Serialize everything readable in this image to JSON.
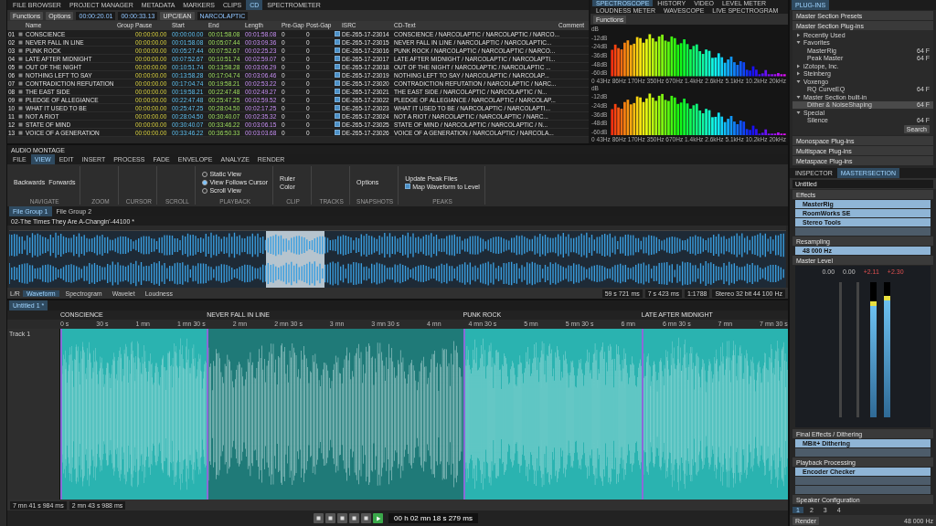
{
  "cd_panel": {
    "tabs": [
      {
        "label": "FILE BROWSER",
        "selected": false
      },
      {
        "label": "PROJECT MANAGER",
        "selected": false
      },
      {
        "label": "METADATA",
        "selected": false
      },
      {
        "label": "MARKERS",
        "selected": false
      },
      {
        "label": "CLIPS",
        "selected": false
      },
      {
        "label": "CD",
        "selected": true
      },
      {
        "label": "SPECTROMETER",
        "selected": false
      }
    ],
    "toolbar": {
      "buttons": [
        "Functions",
        "Options"
      ],
      "time_a": "00:00:20.01",
      "time_b": "00:00:33.13",
      "code_label": "UPC/EAN",
      "album": "NARCOLAPTIC"
    },
    "columns": [
      "Name",
      "Group",
      "Pause",
      "Start",
      "End",
      "Length",
      "Pre-Gap",
      "Post-Gap",
      "ISRC",
      "CD-Text",
      "Comment"
    ],
    "rows": [
      {
        "num": "01",
        "name": "CONSCIENCE",
        "pause": "00:00:00.00",
        "start": "00:00:00.00",
        "end": "00:01:58.08",
        "length": "00:01:58.08",
        "pre": "0",
        "post": "0",
        "checked": true,
        "isrc": "DE-265-17-23014",
        "cdtext": "CONSCIENCE / NARCOLAPTIC / NARCOLAPTIC / NARCO..."
      },
      {
        "num": "02",
        "name": "NEVER FALL IN LINE",
        "pause": "00:00:00.00",
        "start": "00:01:58.08",
        "end": "00:05:07.44",
        "length": "00:03:09.36",
        "pre": "0",
        "post": "0",
        "checked": true,
        "isrc": "DE-265-17-23015",
        "cdtext": "NEVER FALL IN LINE / NARCOLAPTIC / NARCOLAPTIC..."
      },
      {
        "num": "03",
        "name": "PUNK ROCK",
        "pause": "00:00:00.00",
        "start": "00:05:27.44",
        "end": "00:07:52.67",
        "length": "00:02:25.23",
        "pre": "0",
        "post": "0",
        "checked": true,
        "isrc": "DE-265-17-23016",
        "cdtext": "PUNK ROCK / NARCOLAPTIC / NARCOLAPTIC / NARCO..."
      },
      {
        "num": "04",
        "name": "LATE AFTER MIDNIGHT",
        "pause": "00:00:00.00",
        "start": "00:07:52.67",
        "end": "00:10:51.74",
        "length": "00:02:59.07",
        "pre": "0",
        "post": "0",
        "checked": true,
        "isrc": "DE-265-17-23017",
        "cdtext": "LATE AFTER MIDNIGHT / NARCOLAPTIC / NARCOLAPTI..."
      },
      {
        "num": "05",
        "name": "OUT OF THE NIGHT",
        "pause": "00:00:00.00",
        "start": "00:10:51.74",
        "end": "00:13:58.28",
        "length": "00:03:06.29",
        "pre": "0",
        "post": "0",
        "checked": true,
        "isrc": "DE-265-17-23018",
        "cdtext": "OUT OF THE NIGHT / NARCOLAPTIC / NARCOLAPTIC ..."
      },
      {
        "num": "06",
        "name": "NOTHING LEFT TO SAY",
        "pause": "00:00:00.00",
        "start": "00:13:58.28",
        "end": "00:17:04.74",
        "length": "00:03:06.46",
        "pre": "0",
        "post": "0",
        "checked": true,
        "isrc": "DE-265-17-23019",
        "cdtext": "NOTHING LEFT TO SAY / NARCOLAPTIC / NARCOLAP..."
      },
      {
        "num": "07",
        "name": "CONTRADICTION REFUTATION",
        "pause": "00:00:00.00",
        "start": "00:17:04.74",
        "end": "00:19:58.21",
        "length": "00:02:53.22",
        "pre": "0",
        "post": "0",
        "checked": true,
        "isrc": "DE-265-17-23020",
        "cdtext": "CONTRADICTION REFUTATION / NARCOLAPTIC / NARC..."
      },
      {
        "num": "08",
        "name": "THE EAST SIDE",
        "pause": "00:00:00.00",
        "start": "00:19:58.21",
        "end": "00:22:47.48",
        "length": "00:02:49.27",
        "pre": "0",
        "post": "0",
        "checked": true,
        "isrc": "DE-265-17-23021",
        "cdtext": "THE EAST SIDE / NARCOLAPTIC / NARCOLAPTIC / N..."
      },
      {
        "num": "09",
        "name": "PLEDGE OF ALLEGIANCE",
        "pause": "00:00:00.00",
        "start": "00:22:47.48",
        "end": "00:25:47.25",
        "length": "00:02:59.52",
        "pre": "0",
        "post": "0",
        "checked": true,
        "isrc": "DE-265-17-23022",
        "cdtext": "PLEDGE OF ALLEGIANCE / NARCOLAPTIC / NARCOLAP..."
      },
      {
        "num": "10",
        "name": "WHAT IT USED TO BE",
        "pause": "00:00:00.00",
        "start": "00:25:47.25",
        "end": "00:28:04.50",
        "length": "00:02:17.25",
        "pre": "0",
        "post": "0",
        "checked": true,
        "isrc": "DE-265-17-23023",
        "cdtext": "WHAT IT USED TO BE / NARCOLAPTIC / NARCOLAPTI..."
      },
      {
        "num": "11",
        "name": "NOT A RIOT",
        "pause": "00:00:00.00",
        "start": "00:28:04.50",
        "end": "00:30:40.07",
        "length": "00:02:35.32",
        "pre": "0",
        "post": "0",
        "checked": true,
        "isrc": "DE-265-17-23024",
        "cdtext": "NOT A RIOT / NARCOLAPTIC / NARCOLAPTIC / NARC..."
      },
      {
        "num": "12",
        "name": "STATE OF MIND",
        "pause": "00:00:00.00",
        "start": "00:30:40.07",
        "end": "00:33:46.22",
        "length": "00:03:06.15",
        "pre": "0",
        "post": "0",
        "checked": true,
        "isrc": "DE-265-17-23025",
        "cdtext": "STATE OF MIND / NARCOLAPTIC / NARCOLAPTIC / N..."
      },
      {
        "num": "13",
        "name": "VOICE OF A GENERATION",
        "pause": "00:00:00.00",
        "start": "00:33:46.22",
        "end": "00:36:50.33",
        "length": "00:03:03.68",
        "pre": "0",
        "post": "0",
        "checked": true,
        "isrc": "DE-265-17-23026",
        "cdtext": "VOICE OF A GENERATION / NARCOLAPTIC / NARCOLA..."
      }
    ]
  },
  "spectrum_panel": {
    "tabs": [
      {
        "label": "SPECTROSCOPE",
        "selected": true
      },
      {
        "label": "HISTORY",
        "selected": false
      },
      {
        "label": "VIDEO",
        "selected": false
      },
      {
        "label": "LEVEL METER",
        "selected": false
      },
      {
        "label": "LOUDNESS METER",
        "selected": false
      },
      {
        "label": "WAVESCOPE",
        "selected": false
      },
      {
        "label": "LIVE SPECTROGRAM",
        "selected": false
      }
    ],
    "functions": "Functions",
    "charts": [
      {
        "unit": "dB",
        "y_labels": [
          "-12dB",
          "-24dB",
          "-36dB",
          "-48dB",
          "-60dB"
        ],
        "x_labels": [
          "0",
          "43Hz",
          "86Hz",
          "170Hz",
          "350Hz",
          "670Hz",
          "1.4kHz",
          "2.6kHz",
          "5.1kHz",
          "10.2kHz",
          "20kHz"
        ]
      },
      {
        "unit": "dB",
        "y_labels": [
          "-12dB",
          "-24dB",
          "-36dB",
          "-48dB",
          "-60dB"
        ],
        "x_labels": [
          "0",
          "43Hz",
          "86Hz",
          "170Hz",
          "350Hz",
          "670Hz",
          "1.4kHz",
          "2.6kHz",
          "5.1kHz",
          "10.2kHz",
          "20kHz"
        ]
      }
    ]
  },
  "montage": {
    "title": "AUDIO MONTAGE",
    "ribbon_tabs": [
      {
        "label": "FILE",
        "selected": false
      },
      {
        "label": "VIEW",
        "selected": true
      },
      {
        "label": "EDIT",
        "selected": false
      },
      {
        "label": "INSERT",
        "selected": false
      },
      {
        "label": "PROCESS",
        "selected": false
      },
      {
        "label": "FADE",
        "selected": false
      },
      {
        "label": "ENVELOPE",
        "selected": false
      },
      {
        "label": "ANALYZE",
        "selected": false
      },
      {
        "label": "RENDER",
        "selected": false
      }
    ],
    "groups": [
      "NAVIGATE",
      "ZOOM",
      "CURSOR",
      "SCROLL",
      "PLAYBACK",
      "CLIP",
      "TRACKS",
      "SNAPSHOTS",
      "PEAKS"
    ],
    "nav": [
      "Backwards",
      "Forwards"
    ],
    "playback": [
      {
        "label": "Static View",
        "selected": false
      },
      {
        "label": "View Follows Cursor",
        "selected": true
      },
      {
        "label": "Scroll View",
        "selected": false
      }
    ],
    "clip": [
      "Ruler",
      "Color"
    ],
    "snapshots": "Options",
    "peaks_button": "Update Peak Files",
    "map_waveform": {
      "label": "Map Waveform to Level",
      "checked": true
    },
    "file_tabs": [
      {
        "label": "File Group 1",
        "selected": true
      },
      {
        "label": "File Group 2",
        "selected": false
      }
    ],
    "wave_title": "02-The Times They Are A-Changin'-44100 *",
    "view_label": "L/R",
    "view_tabs": [
      {
        "label": "Waveform",
        "selected": true
      },
      {
        "label": "Spectrogram",
        "selected": false
      },
      {
        "label": "Wavelet",
        "selected": false
      },
      {
        "label": "Loudness",
        "selected": false
      }
    ],
    "status": [
      "59 s 721 ms",
      "7 s 423 ms",
      "1:1788",
      "Stereo 32 bit 44 100 Hz"
    ],
    "montage_tab": "Untitled 1 *",
    "ruler": [
      "0 s",
      "30 s",
      "1 mn",
      "1 mn 30 s",
      "2 mn",
      "2 mn 30 s",
      "3 mn",
      "3 mn 30 s",
      "4 mn",
      "4 mn 30 s",
      "5 mn",
      "5 mn 30 s",
      "6 mn",
      "6 mn 30 s",
      "7 mn",
      "7 mn 30 s"
    ],
    "track": {
      "name": "Track 1"
    },
    "clips": [
      {
        "marker": "CONSCIENCE",
        "selected": false
      },
      {
        "marker": "NEVER FALL IN LINE",
        "selected": true
      },
      {
        "marker": "PUNK ROCK",
        "selected": false
      },
      {
        "marker": "LATE AFTER MIDNIGHT",
        "selected": false
      }
    ],
    "bottom_status": [
      "7 mn 41 s 984 ms",
      "2 mn 43 s 988 ms"
    ]
  },
  "transport": {
    "time": "00 h 02 mn 18 s 279 ms",
    "playing": true
  },
  "plugins": {
    "title": "PLUG-INS",
    "sections": [
      "Master Section Presets",
      "Master Section Plug-ins"
    ],
    "tree": [
      {
        "label": "Recently Used",
        "expanded": false
      },
      {
        "label": "Favorites",
        "expanded": true,
        "children": [
          {
            "label": "MasterRig",
            "tag": "64 F",
            "selected": false
          },
          {
            "label": "Peak Master",
            "tag": "64 F",
            "selected": false
          }
        ]
      },
      {
        "label": "iZotope, Inc.",
        "expanded": false
      },
      {
        "label": "Steinberg",
        "expanded": false
      },
      {
        "label": "Voxengo",
        "expanded": true,
        "children": [
          {
            "label": "RQ CurveEQ",
            "tag": "64 F",
            "selected": false
          }
        ]
      },
      {
        "label": "Master Section built-in",
        "expanded": true,
        "children": [
          {
            "label": "Dither & NoiseShaping",
            "tag": "64 F",
            "selected": true
          }
        ]
      },
      {
        "label": "Special",
        "expanded": true,
        "children": [
          {
            "label": "Silence",
            "tag": "64 F",
            "selected": false
          }
        ]
      }
    ],
    "search": "Search",
    "more": [
      "Monospace Plug-ins",
      "Multispace Plug-ins",
      "Metaspace Plug-ins"
    ]
  },
  "inspector": {
    "tabs": [
      {
        "label": "INSPECTOR",
        "selected": false
      },
      {
        "label": "MASTERSECTION",
        "selected": true
      }
    ],
    "preset": "Untitled",
    "effects_title": "Effects",
    "effects": [
      "MasterRig",
      "RoomWorks SE",
      "Stereo Tools"
    ],
    "resampling_title": "Resampling",
    "resampling": "48 000 Hz",
    "master_title": "Master Level",
    "readouts": [
      {
        "text": "0.00",
        "kind": "gain"
      },
      {
        "text": "0.00",
        "kind": "gain"
      },
      {
        "text": "+2.11",
        "kind": "peak"
      },
      {
        "text": "+2.30",
        "kind": "peak"
      }
    ],
    "meters": [
      {
        "level": 0.86
      },
      {
        "level": 0.9
      }
    ],
    "final_title": "Final Effects / Dithering",
    "final": [
      "MBit+ Dithering"
    ],
    "playback_title": "Playback Processing",
    "playback": [
      "Encoder Checker"
    ],
    "speaker_title": "Speaker Configuration",
    "speakers": [
      {
        "label": "1",
        "selected": true
      },
      {
        "label": "2",
        "selected": false
      },
      {
        "label": "3",
        "selected": false
      },
      {
        "label": "4",
        "selected": false
      }
    ],
    "render": "Render",
    "rate": "48 000 Hz"
  }
}
